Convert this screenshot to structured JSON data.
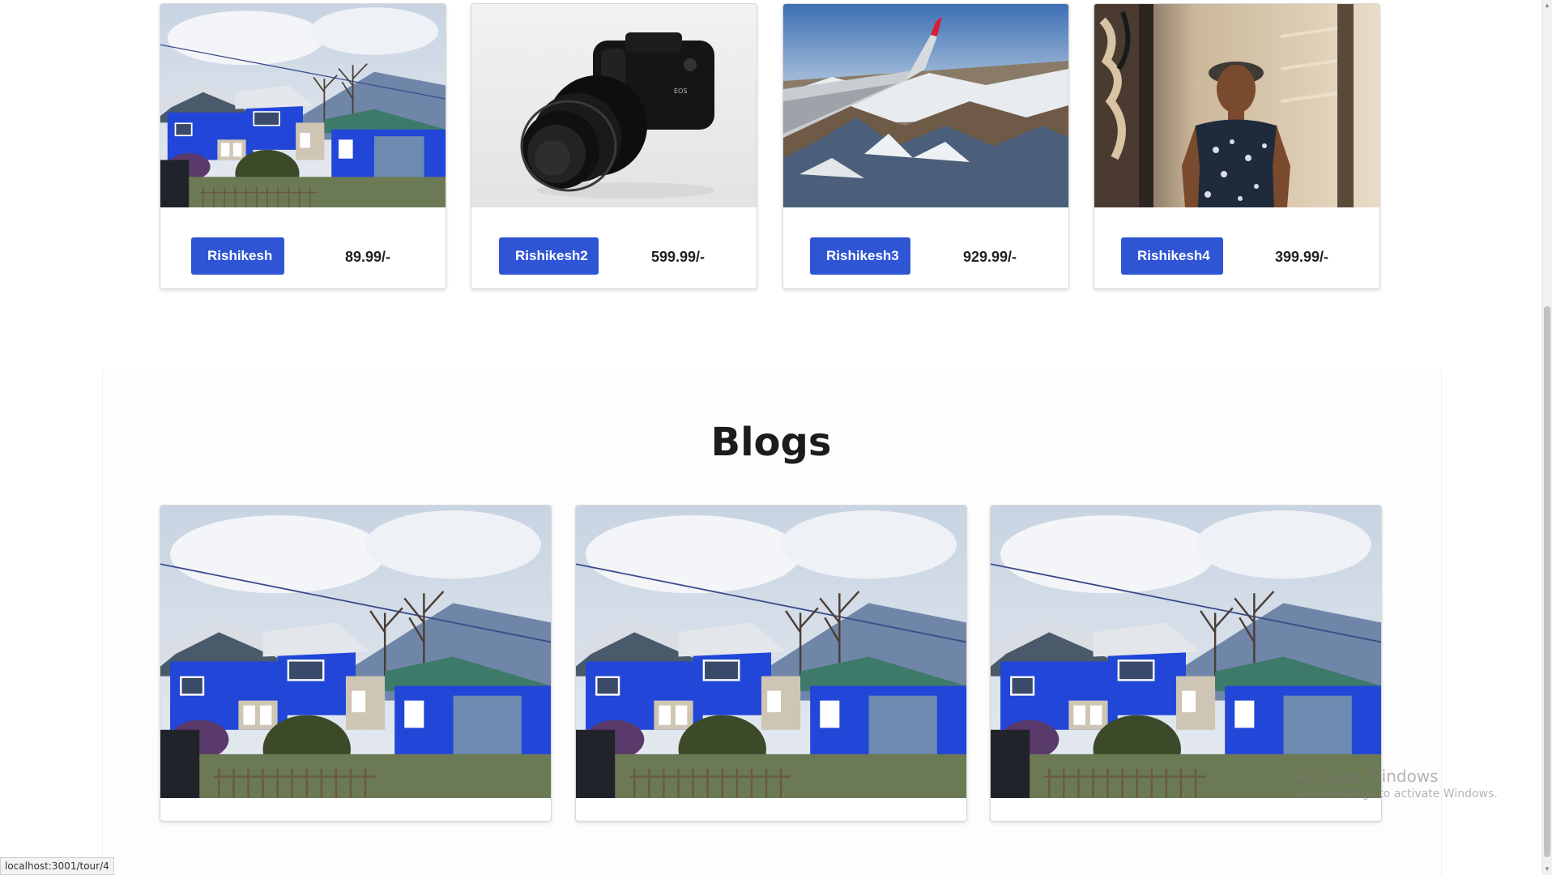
{
  "tours": [
    {
      "name": "Rishikesh",
      "price": "89.99/-",
      "image": "blue-houses-mountain-photo"
    },
    {
      "name": "Rishikesh2",
      "price": "599.99/-",
      "image": "dslr-camera-photo"
    },
    {
      "name": "Rishikesh3",
      "price": "929.99/-",
      "image": "airplane-wing-mountains-photo"
    },
    {
      "name": "Rishikesh4",
      "price": "399.99/-",
      "image": "woman-portrait-photo"
    }
  ],
  "blogs": {
    "title": "Blogs",
    "items": [
      {
        "image": "blue-houses-mountain-photo"
      },
      {
        "image": "blue-houses-mountain-photo"
      },
      {
        "image": "blue-houses-mountain-photo"
      }
    ]
  },
  "status_bar": {
    "url": "localhost:3001/tour/4"
  },
  "watermark": {
    "title": "Activate Windows",
    "subtitle": "Go to Settings to activate Windows."
  },
  "colors": {
    "button": "#2f55d4",
    "button_text": "#ffffff",
    "title": "#1c1c1c"
  }
}
